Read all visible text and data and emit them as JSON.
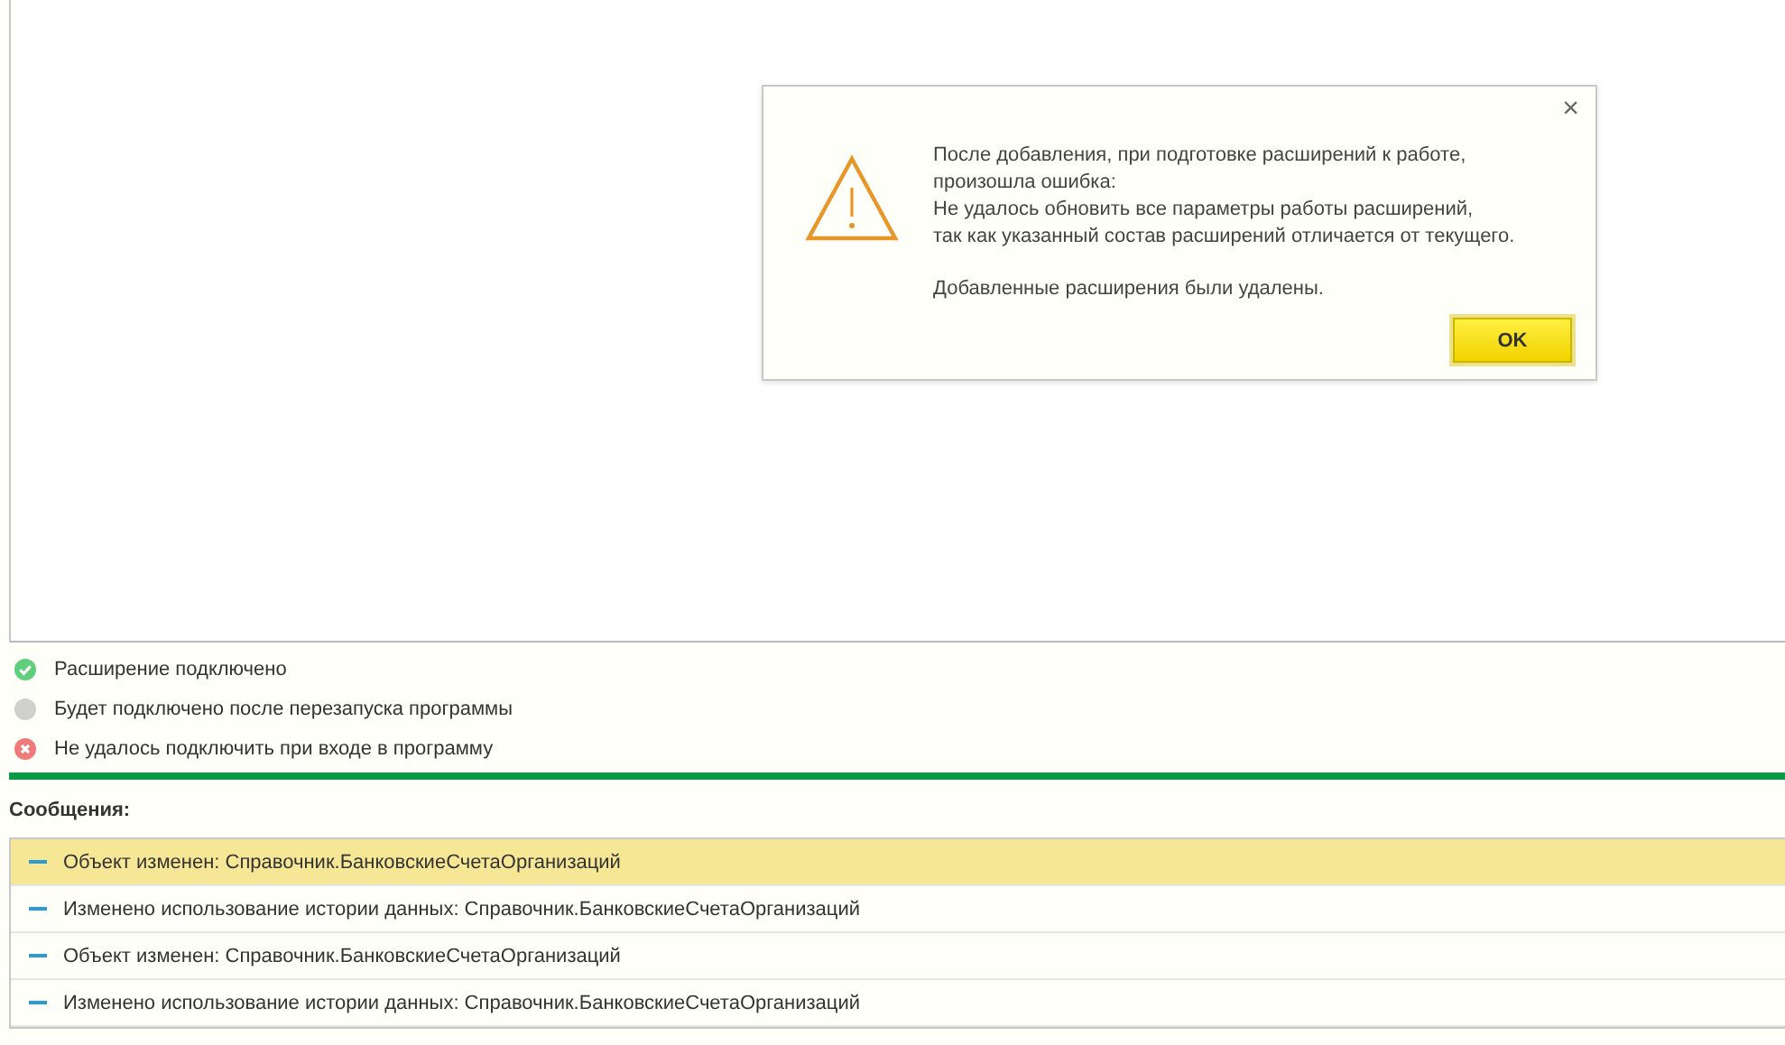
{
  "dialog": {
    "close": "×",
    "paragraphs": [
      [
        "После добавления, при подготовке расширений к работе,",
        "произошла ошибка:",
        "Не удалось обновить все параметры работы расширений,",
        "так как указанный состав расширений отличается от текущего."
      ],
      [
        "Добавленные расширения были удалены."
      ]
    ],
    "button": "OK"
  },
  "legend": [
    {
      "kind": "ok",
      "label": "Расширение подключено"
    },
    {
      "kind": "pending",
      "label": "Будет подключено после перезапуска программы"
    },
    {
      "kind": "error",
      "label": "Не удалось подключить при входе в программу"
    }
  ],
  "messages_title": "Сообщения:",
  "messages": [
    {
      "text": "Объект изменен: Справочник.БанковскиеСчетаОрганизаций",
      "selected": true
    },
    {
      "text": "Изменено использование истории данных: Справочник.БанковскиеСчетаОрганизаций",
      "selected": false
    },
    {
      "text": "Объект изменен: Справочник.БанковскиеСчетаОрганизаций",
      "selected": false
    },
    {
      "text": "Изменено использование истории данных: Справочник.БанковскиеСчетаОрганизаций",
      "selected": false
    }
  ]
}
